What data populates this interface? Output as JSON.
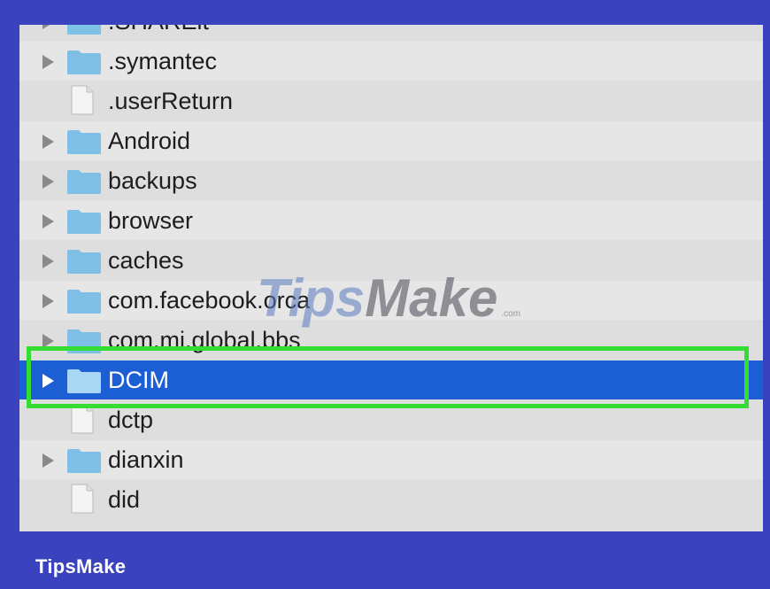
{
  "file_list": [
    {
      "name": ".SHAREit",
      "type": "folder",
      "expandable": true,
      "selected": false
    },
    {
      "name": ".symantec",
      "type": "folder",
      "expandable": true,
      "selected": false
    },
    {
      "name": ".userReturn",
      "type": "file",
      "expandable": false,
      "selected": false
    },
    {
      "name": "Android",
      "type": "folder",
      "expandable": true,
      "selected": false
    },
    {
      "name": "backups",
      "type": "folder",
      "expandable": true,
      "selected": false
    },
    {
      "name": "browser",
      "type": "folder",
      "expandable": true,
      "selected": false
    },
    {
      "name": "caches",
      "type": "folder",
      "expandable": true,
      "selected": false
    },
    {
      "name": "com.facebook.orca",
      "type": "folder",
      "expandable": true,
      "selected": false
    },
    {
      "name": "com.mi.global.bbs",
      "type": "folder",
      "expandable": true,
      "selected": false
    },
    {
      "name": "DCIM",
      "type": "folder",
      "expandable": true,
      "selected": true
    },
    {
      "name": "dctp",
      "type": "file",
      "expandable": false,
      "selected": false
    },
    {
      "name": "dianxin",
      "type": "folder",
      "expandable": true,
      "selected": false
    },
    {
      "name": "did",
      "type": "file",
      "expandable": false,
      "selected": false
    }
  ],
  "watermark": {
    "part1": "Tips",
    "part2": "Make",
    "domain": ".com"
  },
  "footer": {
    "brand": "TipsMake"
  },
  "colors": {
    "frame": "#3a43bd",
    "selection": "#1c5ed4",
    "highlight_outline": "#33dd33",
    "folder": "#7fbfe6"
  }
}
